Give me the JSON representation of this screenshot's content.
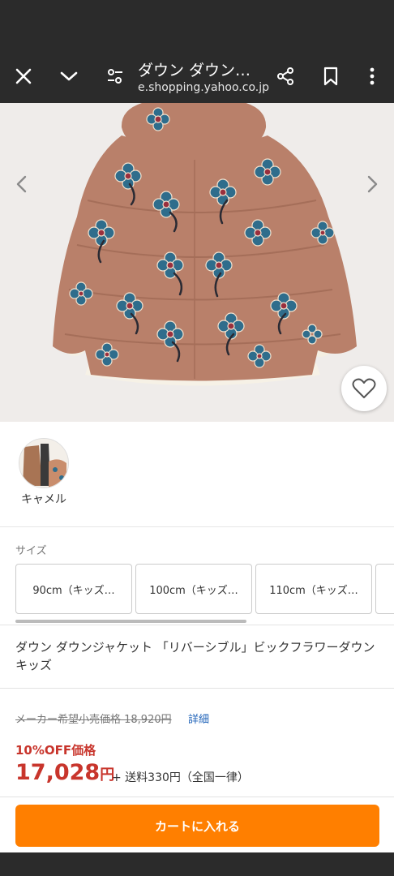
{
  "toolbar": {
    "title": "ダウン ダウン…",
    "url": "e.shopping.yahoo.co.jp"
  },
  "color_options": [
    {
      "label": "キャメル"
    }
  ],
  "size_section": {
    "label": "サイズ",
    "options": [
      "90cm（キッズ…",
      "100cm（キッズ…",
      "110cm（キッズ…"
    ]
  },
  "product": {
    "title": "ダウン ダウンジャケット 「リバーシブル」ビックフラワーダウン キッズ",
    "original_price": "メーカー希望小売価格 18,920円",
    "detail_link": "詳細",
    "discount_label": "10%OFF価格",
    "price": "17,028",
    "price_unit": "円",
    "shipping": "+ 送料330円（全国一律）"
  },
  "cart": {
    "button_label": "カートに入れる"
  },
  "colors": {
    "accent": "#ff7f00",
    "price_red": "#c8352c",
    "link_blue": "#1e62b8",
    "toolbar_bg": "#2b2b2b"
  }
}
